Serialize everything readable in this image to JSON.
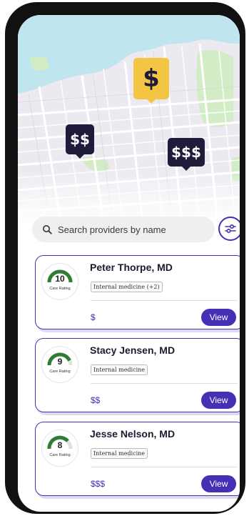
{
  "map": {
    "markers": [
      {
        "label": "$",
        "style": "gold"
      },
      {
        "label": "$$",
        "style": "dark"
      },
      {
        "label": "$$$",
        "style": "dark"
      }
    ]
  },
  "search": {
    "placeholder": "Search providers by name"
  },
  "providers": [
    {
      "name": "Peter Thorpe, MD",
      "rating": "10",
      "rating_label": "Care Rating",
      "specialty": "Internal medicine (+2)",
      "price": "$",
      "action": "View"
    },
    {
      "name": "Stacy Jensen, MD",
      "rating": "9",
      "rating_label": "Care Rating",
      "specialty": "Internal medicine",
      "price": "$$",
      "action": "View"
    },
    {
      "name": "Jesse Nelson, MD",
      "rating": "8",
      "rating_label": "Care Rating",
      "specialty": "Internal medicine",
      "price": "$$$",
      "action": "View"
    }
  ],
  "colors": {
    "accent": "#4330b5",
    "gold_marker": "#f4c542",
    "dark_marker": "#1f1b3a",
    "gauge_green": "#2e7d32"
  }
}
